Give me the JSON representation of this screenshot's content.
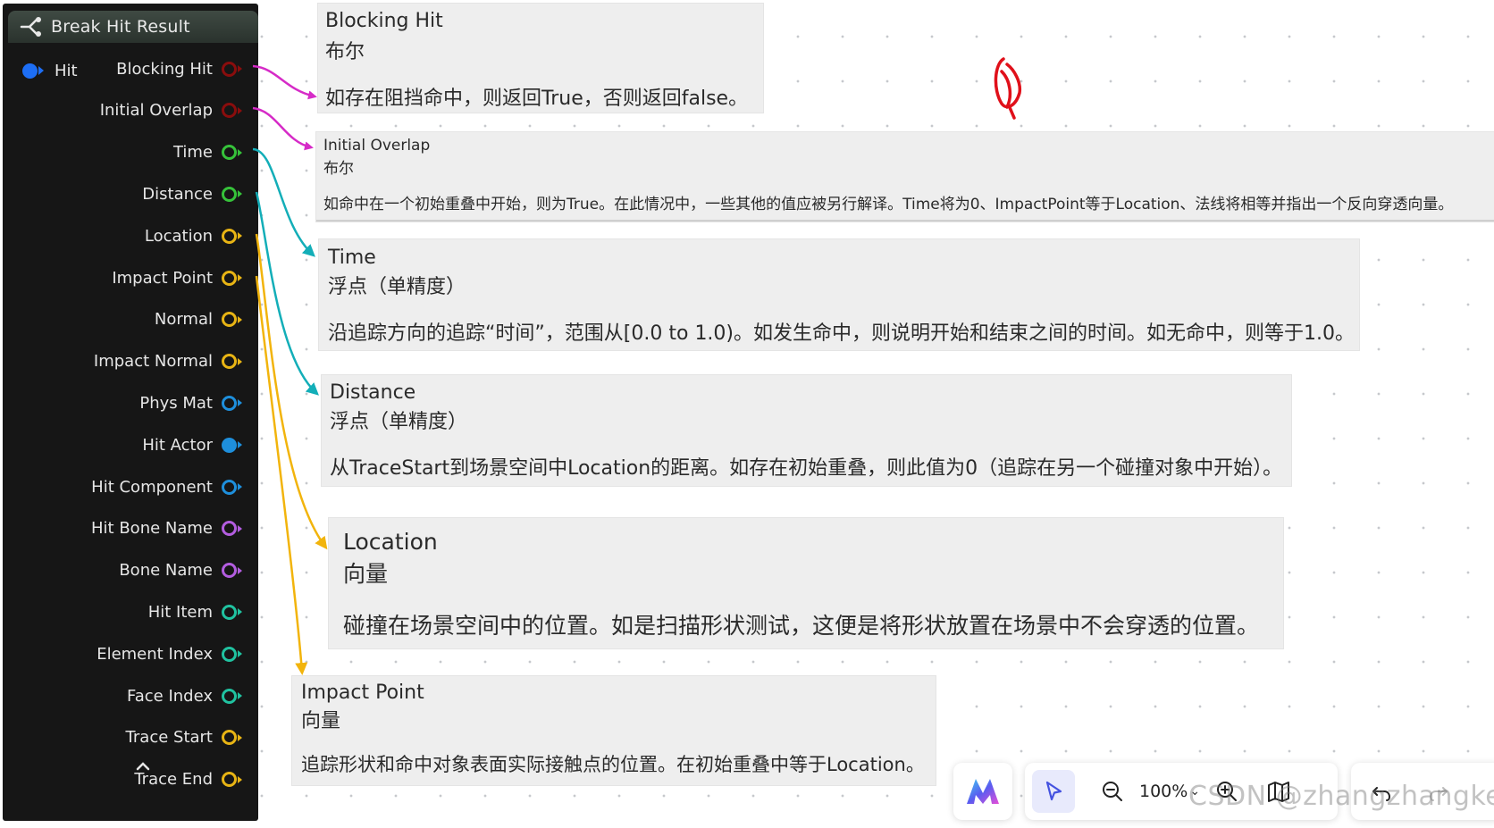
{
  "node": {
    "title": "Break Hit Result",
    "input_pin": {
      "label": "Hit",
      "color": "#1d6ef5"
    },
    "output_pins": [
      {
        "label": "Blocking Hit",
        "color": "#8a0d0d",
        "filled": false,
        "type": "bool"
      },
      {
        "label": "Initial Overlap",
        "color": "#8a0d0d",
        "filled": false,
        "type": "bool"
      },
      {
        "label": "Time",
        "color": "#36c23a",
        "filled": false,
        "type": "float"
      },
      {
        "label": "Distance",
        "color": "#36c23a",
        "filled": false,
        "type": "float"
      },
      {
        "label": "Location",
        "color": "#e8b414",
        "filled": false,
        "type": "vector"
      },
      {
        "label": "Impact Point",
        "color": "#e8b414",
        "filled": false,
        "type": "vector"
      },
      {
        "label": "Normal",
        "color": "#e8b414",
        "filled": false,
        "type": "vector"
      },
      {
        "label": "Impact Normal",
        "color": "#e8b414",
        "filled": false,
        "type": "vector"
      },
      {
        "label": "Phys Mat",
        "color": "#1e8fdc",
        "filled": false,
        "type": "object"
      },
      {
        "label": "Hit Actor",
        "color": "#1e8fdc",
        "filled": true,
        "type": "object"
      },
      {
        "label": "Hit Component",
        "color": "#1e8fdc",
        "filled": false,
        "type": "object"
      },
      {
        "label": "Hit Bone Name",
        "color": "#b35de0",
        "filled": false,
        "type": "name"
      },
      {
        "label": "Bone Name",
        "color": "#b35de0",
        "filled": false,
        "type": "name"
      },
      {
        "label": "Hit Item",
        "color": "#20c2a0",
        "filled": false,
        "type": "int"
      },
      {
        "label": "Element Index",
        "color": "#20c2a0",
        "filled": false,
        "type": "int"
      },
      {
        "label": "Face Index",
        "color": "#20c2a0",
        "filled": false,
        "type": "int"
      },
      {
        "label": "Trace Start",
        "color": "#e8b414",
        "filled": false,
        "type": "vector"
      },
      {
        "label": "Trace End",
        "color": "#e8b414",
        "filled": false,
        "type": "vector"
      }
    ]
  },
  "tooltips": {
    "blocking_hit": {
      "name": "Blocking Hit",
      "type": "布尔",
      "desc": "如存在阻挡命中，则返回True，否则返回false。"
    },
    "initial_overlap": {
      "name": "Initial Overlap",
      "type": "布尔",
      "desc": "如命中在一个初始重叠中开始，则为True。在此情况中，一些其他的值应被另行解译。Time将为0、ImpactPoint等于Location、法线将相等并指出一个反向穿透向量。"
    },
    "time": {
      "name": "Time",
      "type": "浮点（单精度）",
      "desc": "沿追踪方向的追踪“时间”，范围从[0.0 to 1.0)。如发生命中，则说明开始和结束之间的时间。如无命中，则等于1.0。"
    },
    "distance": {
      "name": "Distance",
      "type": "浮点（单精度）",
      "desc": "从TraceStart到场景空间中Location的距离。如存在初始重叠，则此值为0（追踪在另一个碰撞对象中开始）。"
    },
    "location": {
      "name": "Location",
      "type": "向量",
      "desc": "碰撞在场景空间中的位置。如是扫描形状测试，这便是将形状放置在场景中不会穿透的位置。"
    },
    "impact_point": {
      "name": "Impact Point",
      "type": "向量",
      "desc": "追踪形状和命中对象表面实际接触点的位置。在初始重叠中等于Location。"
    }
  },
  "colors": {
    "wire_bool": "#d62bc7",
    "wire_float": "#13aeb8",
    "wire_vector": "#f2b40c",
    "annotation": "#e0101a",
    "accent": "#4452e0"
  },
  "toolbar": {
    "zoom_level": "100%",
    "zoom_caret": "⌄",
    "icons": [
      "brand-logo-icon",
      "select-pointer-icon",
      "zoom-out-icon",
      "zoom-in-icon",
      "minimap-icon",
      "undo-icon",
      "redo-icon"
    ]
  },
  "watermark": "CSDN @zhangzhangkeji"
}
